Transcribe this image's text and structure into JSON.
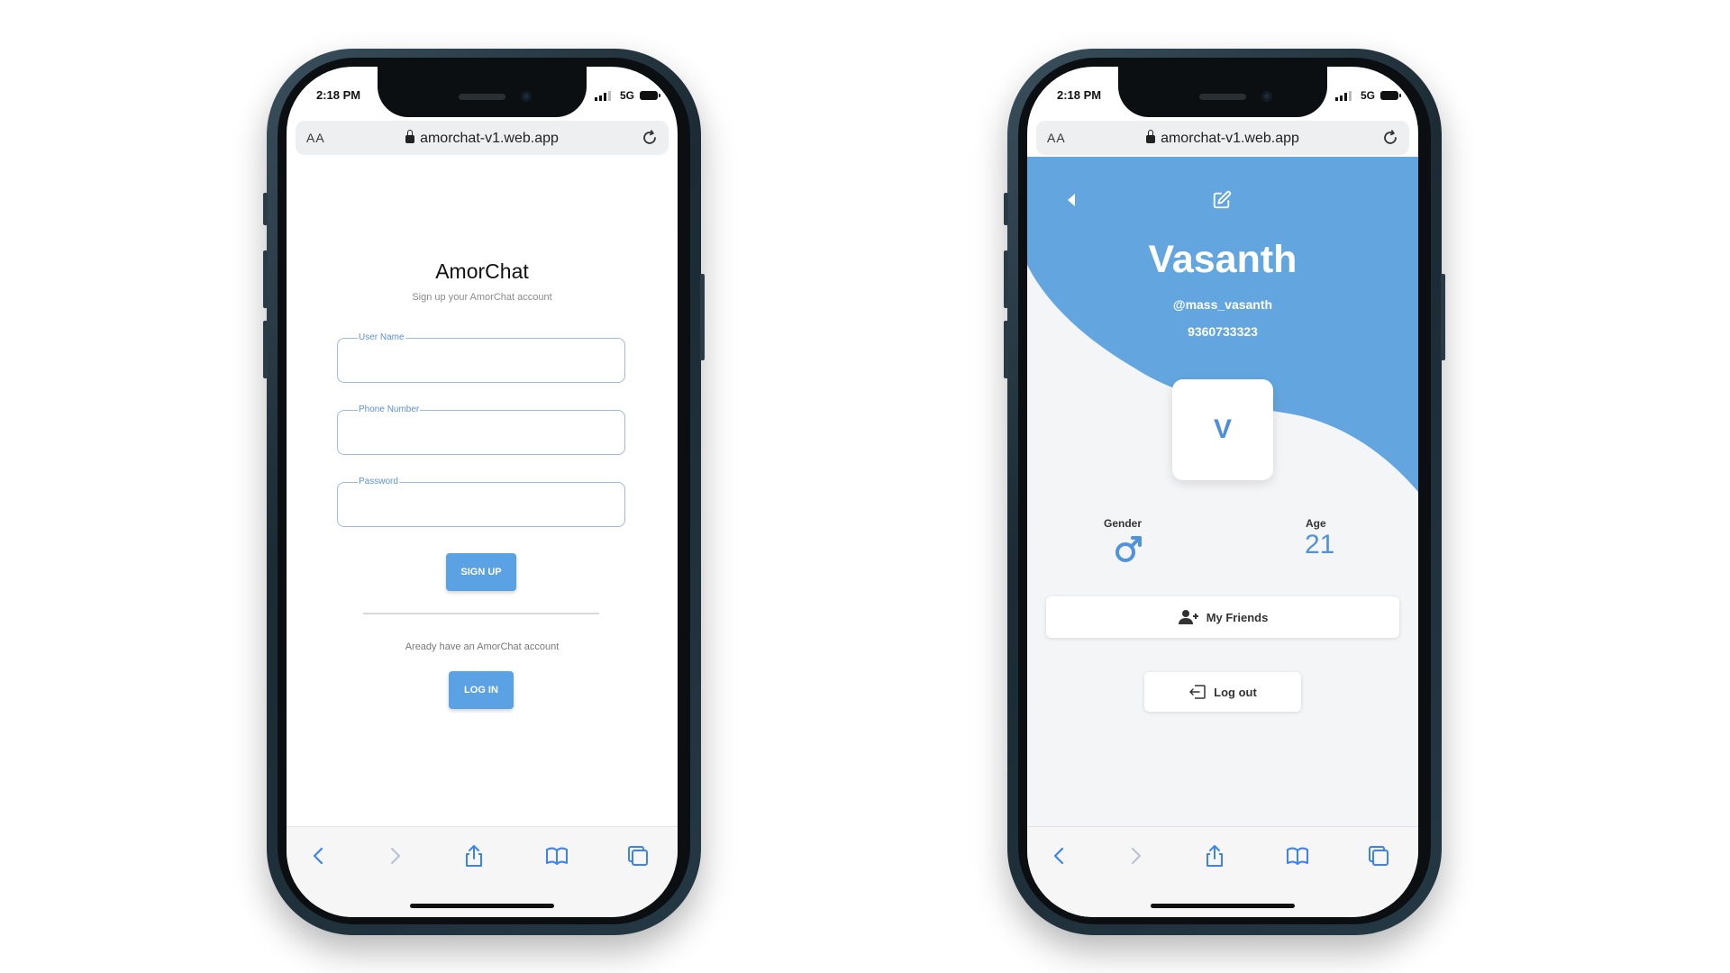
{
  "colors": {
    "accent": "#5aa2e3",
    "wave": "#63a6df",
    "label": "#5c8fd6",
    "ios_blue": "#3b82f6"
  },
  "status_bar": {
    "time": "2:18 PM",
    "network": "5G"
  },
  "browser": {
    "text_size_label": "AA",
    "url": "amorchat-v1.web.app"
  },
  "toolbar_icons": [
    "back-icon",
    "forward-icon",
    "share-icon",
    "bookmarks-icon",
    "tabs-icon"
  ],
  "signup": {
    "title": "AmorChat",
    "subtitle": "Sign up your AmorChat account",
    "fields": {
      "username_label": "User Name",
      "phone_label": "Phone Number",
      "password_label": "Password"
    },
    "signup_button": "SIGN UP",
    "already_text": "Aready have an AmorChat account",
    "login_button": "LOG IN"
  },
  "profile": {
    "name": "Vasanth",
    "handle": "@mass_vasanth",
    "phone": "9360733323",
    "avatar_letter": "V",
    "gender_label": "Gender",
    "gender_icon": "male-icon",
    "age_label": "Age",
    "age": "21",
    "friends_button": "My Friends",
    "logout_button": "Log out"
  }
}
